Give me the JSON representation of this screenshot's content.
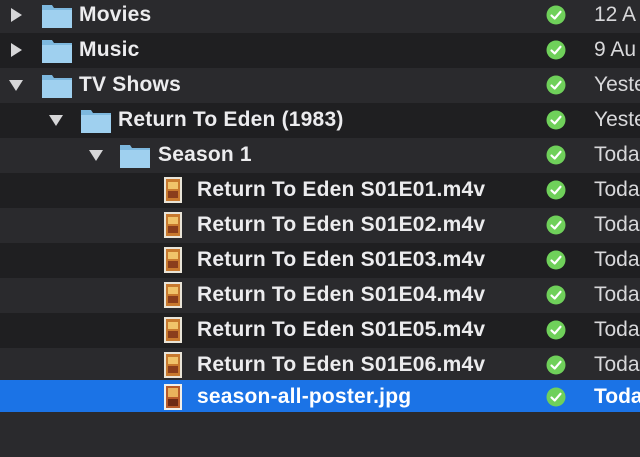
{
  "rows": [
    {
      "name": "Movies",
      "date": "12 A",
      "kind": "folder",
      "expanded": false,
      "depth": 0
    },
    {
      "name": "Music",
      "date": "9 Au",
      "kind": "folder",
      "expanded": false,
      "depth": 0
    },
    {
      "name": "TV Shows",
      "date": "Yeste",
      "kind": "folder",
      "expanded": true,
      "depth": 0
    },
    {
      "name": "Return To Eden (1983)",
      "date": "Yeste",
      "kind": "folder",
      "expanded": true,
      "depth": 1
    },
    {
      "name": "Season 1",
      "date": "Toda",
      "kind": "folder",
      "expanded": true,
      "depth": 2
    },
    {
      "name": "Return To Eden S01E01.m4v",
      "date": "Toda",
      "kind": "video",
      "depth": 3
    },
    {
      "name": "Return To Eden S01E02.m4v",
      "date": "Toda",
      "kind": "video",
      "depth": 3
    },
    {
      "name": "Return To Eden S01E03.m4v",
      "date": "Toda",
      "kind": "video",
      "depth": 3
    },
    {
      "name": "Return To Eden S01E04.m4v",
      "date": "Toda",
      "kind": "video",
      "depth": 3
    },
    {
      "name": "Return To Eden S01E05.m4v",
      "date": "Toda",
      "kind": "video",
      "depth": 3
    },
    {
      "name": "Return To Eden S01E06.m4v",
      "date": "Toda",
      "kind": "video",
      "depth": 3
    },
    {
      "name": "season-all-poster.jpg",
      "date": "Toda",
      "kind": "image",
      "depth": 3,
      "selected": true
    }
  ],
  "colors": {
    "selection": "#1b73e6",
    "sync_check": "#6fd05a",
    "folder": "#8fc6ea"
  },
  "icons": {
    "folder": "folder-icon",
    "video": "video-file-icon",
    "image": "image-file-icon",
    "status": "synced-checkmark-icon",
    "collapsed": "disclosure-collapsed-icon",
    "expanded": "disclosure-expanded-icon"
  }
}
